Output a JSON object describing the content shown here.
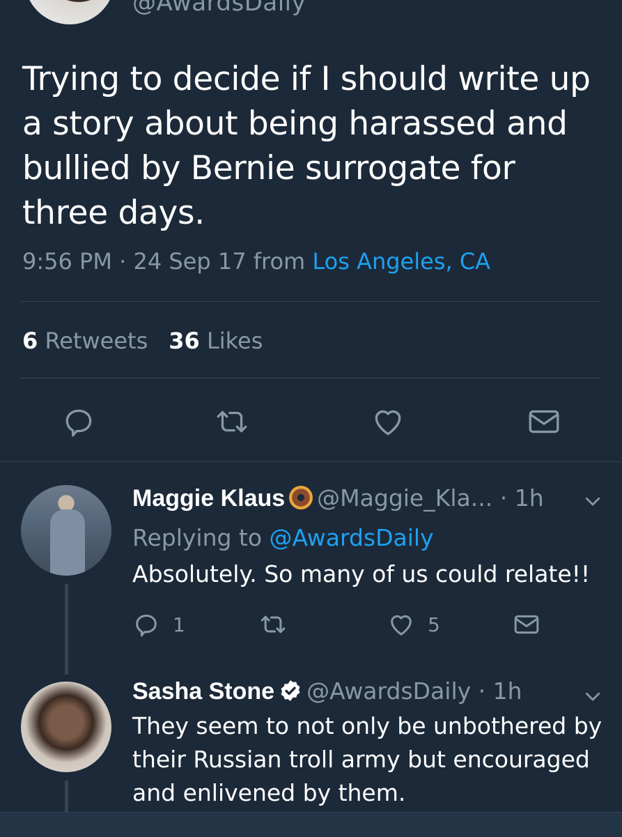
{
  "main_tweet": {
    "handle": "@AwardsDaily",
    "text": "Trying to decide if I should write up a story about being harassed and bullied by Bernie surrogate for three days.",
    "time": "9:56 PM · 24 Sep 17",
    "from_label": "from",
    "location": "Los Angeles, CA",
    "retweets_count": "6",
    "retweets_label": "Retweets",
    "likes_count": "36",
    "likes_label": "Likes"
  },
  "replies": [
    {
      "name": "Maggie Klaus",
      "handle": "@Maggie_Kla...",
      "time": "· 1h",
      "replying_label": "Replying to",
      "replying_to": "@AwardsDaily",
      "text": "Absolutely. So many of us could relate!!",
      "reply_count": "1",
      "like_count": "5"
    },
    {
      "name": "Sasha Stone",
      "handle": "@AwardsDaily",
      "time": "· 1h",
      "text": "They seem to not only be unbothered by their Russian troll army but encouraged and enlivened by them."
    }
  ],
  "icons": {
    "reply": "reply-icon",
    "retweet": "retweet-icon",
    "like": "heart-icon",
    "dm": "envelope-icon",
    "more": "chevron-down-icon",
    "verified": "verified-badge-icon",
    "emoji": "donut-emoji"
  },
  "colors": {
    "background": "#1c2938",
    "text_primary": "#ffffff",
    "text_secondary": "#8899a6",
    "link": "#1da1f2",
    "divider": "#38444d"
  }
}
